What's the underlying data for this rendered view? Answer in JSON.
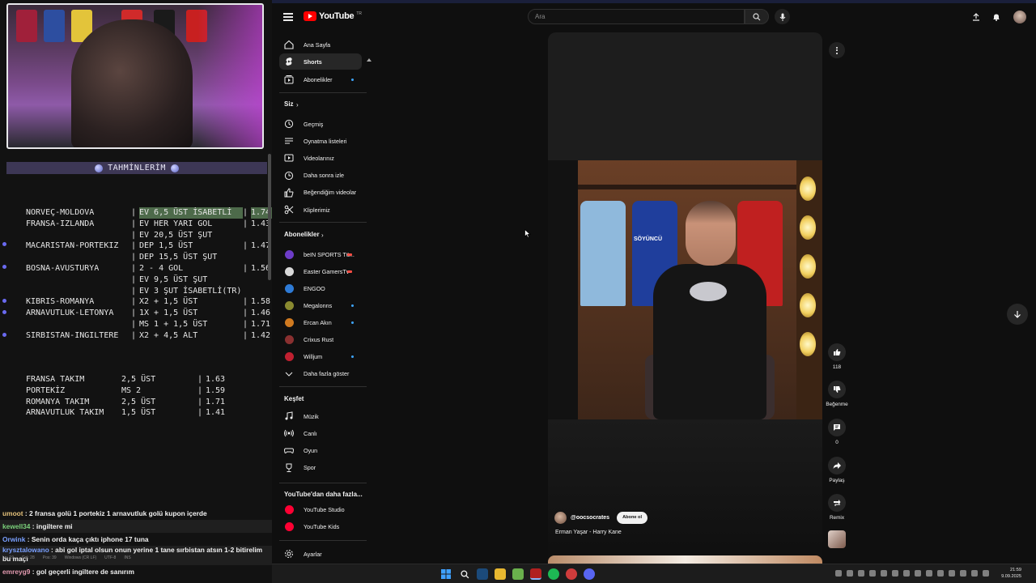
{
  "overlay": {
    "tahmin_title": "TAHMİNLERİM",
    "bets": [
      {
        "match": "NORVEÇ-MOLDOVA",
        "pick": "EV 6,5 ÜST İSABETLİ",
        "odd": "1.74",
        "highlight": true
      },
      {
        "match": "FRANSA-IZLANDA",
        "pick": "EV HER YARI GOL",
        "odd": "1.43"
      },
      {
        "match": "",
        "pick": "EV 20,5 ÜST ŞUT",
        "odd": ""
      },
      {
        "match": "MACARISTAN-PORTEKIZ",
        "pick": "DEP 1,5 ÜST",
        "odd": "1.47"
      },
      {
        "match": "",
        "pick": "DEP 15,5 ÜST ŞUT",
        "odd": ""
      },
      {
        "match": "BOSNA-AVUSTURYA",
        "pick": "2 - 4 GOL",
        "odd": "1.56"
      },
      {
        "match": "",
        "pick": "EV 9,5 ÜST ŞUT",
        "odd": ""
      },
      {
        "match": "",
        "pick": "EV 3 ŞUT İSABETLİ(TR)",
        "odd": ""
      },
      {
        "match": "KIBRIS-ROMANYA",
        "pick": "X2 + 1,5 ÜST",
        "odd": "1.58"
      },
      {
        "match": "ARNAVUTLUK-LETONYA",
        "pick": "1X + 1,5 ÜST",
        "odd": "1.46"
      },
      {
        "match": "",
        "pick": "MS 1 + 1,5 ÜST",
        "odd": "1.71"
      },
      {
        "match": "SIRBISTAN-INGILTERE",
        "pick": "X2 + 4,5 ALT",
        "odd": "1.42"
      }
    ],
    "team_bets": [
      {
        "team": "FRANSA TAKIM",
        "pick": "2,5 ÜST",
        "odd": "1.63"
      },
      {
        "team": "PORTEKİZ",
        "pick": "MS 2",
        "odd": "1.59"
      },
      {
        "team": "ROMANYA TAKIM",
        "pick": "2,5 ÜST",
        "odd": "1.71"
      },
      {
        "team": "ARNAVUTLUK TAKIM",
        "pick": "1,5 ÜST",
        "odd": "1.41"
      }
    ],
    "chat": [
      {
        "user": "umoot",
        "user_color": "#e3c07a",
        "msg": "2 fransa golü 1 portekiz 1 arnavutluk golü kupon içerde"
      },
      {
        "user": "kewell34",
        "user_color": "#7ad07a",
        "msg": "ingiltere mi"
      },
      {
        "user": "Orwink",
        "user_color": "#7aa0ff",
        "msg": "Senin orda kaça çıktı iphone 17 tuna"
      },
      {
        "user": "krysztalowano",
        "user_color": "#7aa0ff",
        "msg": "abi gol iptal olsun onun yerine 1 tane sırbistan atsın 1-2 bitirelim bu maçı"
      },
      {
        "user": "emreyg9",
        "user_color": "#e39ab0",
        "msg": "gol geçerli ingiltere de sanırım"
      }
    ],
    "statusbar": [
      "Ln: 19",
      "Col: 28",
      "Pos: 39",
      "Windows (CR LF)",
      "UTF-8",
      "INS"
    ]
  },
  "youtube": {
    "logo_text": "YouTube",
    "logo_country": "TR",
    "search_placeholder": "Ara",
    "sidebar": {
      "main": [
        {
          "label": "Ana Sayfa",
          "icon": "home-icon"
        },
        {
          "label": "Shorts",
          "icon": "shorts-icon",
          "active": true
        },
        {
          "label": "Abonelikler",
          "icon": "subscriptions-icon",
          "dot": true
        }
      ],
      "you_header": "Siz",
      "you": [
        {
          "label": "Geçmiş",
          "icon": "history-icon"
        },
        {
          "label": "Oynatma listeleri",
          "icon": "playlist-icon"
        },
        {
          "label": "Videolarınız",
          "icon": "your-videos-icon"
        },
        {
          "label": "Daha sonra izle",
          "icon": "watch-later-icon"
        },
        {
          "label": "Beğendiğim videolar",
          "icon": "like-icon"
        },
        {
          "label": "Kliplerimiz",
          "icon": "clips-icon"
        }
      ],
      "subs_header": "Abonelikler",
      "subs": [
        {
          "label": "beIN SPORTS Tü...",
          "color": "#6d3cc8",
          "live": true
        },
        {
          "label": "Easter GamersTv",
          "color": "#d8d8d8",
          "live": true
        },
        {
          "label": "ENGOO",
          "color": "#2e7bd6"
        },
        {
          "label": "Megalonns",
          "color": "#8a8a30",
          "dot": true
        },
        {
          "label": "Ercan Akın",
          "color": "#d07a20",
          "dot": true
        },
        {
          "label": "Crixus Rust",
          "color": "#8a3030"
        },
        {
          "label": "Willjum",
          "color": "#c02030",
          "dot": true
        },
        {
          "label": "Daha fazla göster",
          "color": ""
        }
      ],
      "explore_header": "Keşfet",
      "explore": [
        {
          "label": "Müzik",
          "icon": "music-icon"
        },
        {
          "label": "Canlı",
          "icon": "live-icon"
        },
        {
          "label": "Oyun",
          "icon": "gaming-icon"
        },
        {
          "label": "Spor",
          "icon": "trophy-icon"
        }
      ],
      "more_header": "YouTube'dan daha fazla...",
      "more": [
        {
          "label": "YouTube Studio",
          "color": "#ff0033"
        },
        {
          "label": "YouTube Kids",
          "color": "#ff0033"
        }
      ],
      "settings": "Ayarlar"
    },
    "short": {
      "channel": "@oocsocrates",
      "subscribe": "Abone ol",
      "title": "Erman Yaşar - Harry Kane",
      "shirt_text": "SÖYÜNCÜ"
    },
    "actions": {
      "like_count": "118",
      "dislike_label": "Beğenme",
      "comment_count": "0",
      "share_label": "Paylaş",
      "remix_label": "Remix"
    }
  },
  "taskbar": {
    "time": "21:59",
    "date": "9.09.2025"
  },
  "colors": {
    "youtube_red": "#ff0000",
    "accent_blue": "#3ea6ff",
    "overlay_header": "#3d3755"
  }
}
